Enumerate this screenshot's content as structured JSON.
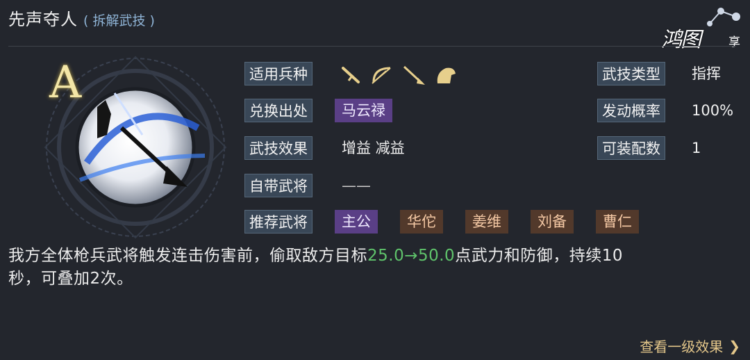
{
  "header": {
    "title": "先声夺人",
    "subtitle": "( 拆解武技 )"
  },
  "watermark": {
    "text": "鸿图",
    "sub": "享"
  },
  "skill": {
    "grade": "A"
  },
  "fields": {
    "troops_label": "适用兵种",
    "source_label": "兑换出处",
    "source_value": "马云禄",
    "effect_label": "武技效果",
    "effect_value": "增益 减益",
    "own_general_label": "自带武将",
    "own_general_value": "——",
    "recommend_label": "推荐武将",
    "recommended": [
      "主公",
      "华佗",
      "姜维",
      "刘备",
      "曹仁"
    ],
    "type_label": "武技类型",
    "type_value": "指挥",
    "chance_label": "发动概率",
    "chance_value": "100%",
    "equip_label": "可装配数",
    "equip_value": "1"
  },
  "troop_icons": [
    "sword-icon",
    "bow-icon",
    "spear-icon",
    "cavalry-icon"
  ],
  "description": {
    "part1": "我方全体枪兵武将触发连击伤害前，偷取敌方目标",
    "highlight": "25.0→50.0",
    "part2": "点武力和防御，持续10",
    "line2": "秒，可叠加2次。"
  },
  "footer": {
    "link_label": "查看一级效果"
  },
  "colors": {
    "highlight": "#5fc36b",
    "label_bg": "#394757",
    "purple_tag": "#5a3f86",
    "brown_tag": "#52392b",
    "link": "#e4c78a"
  }
}
